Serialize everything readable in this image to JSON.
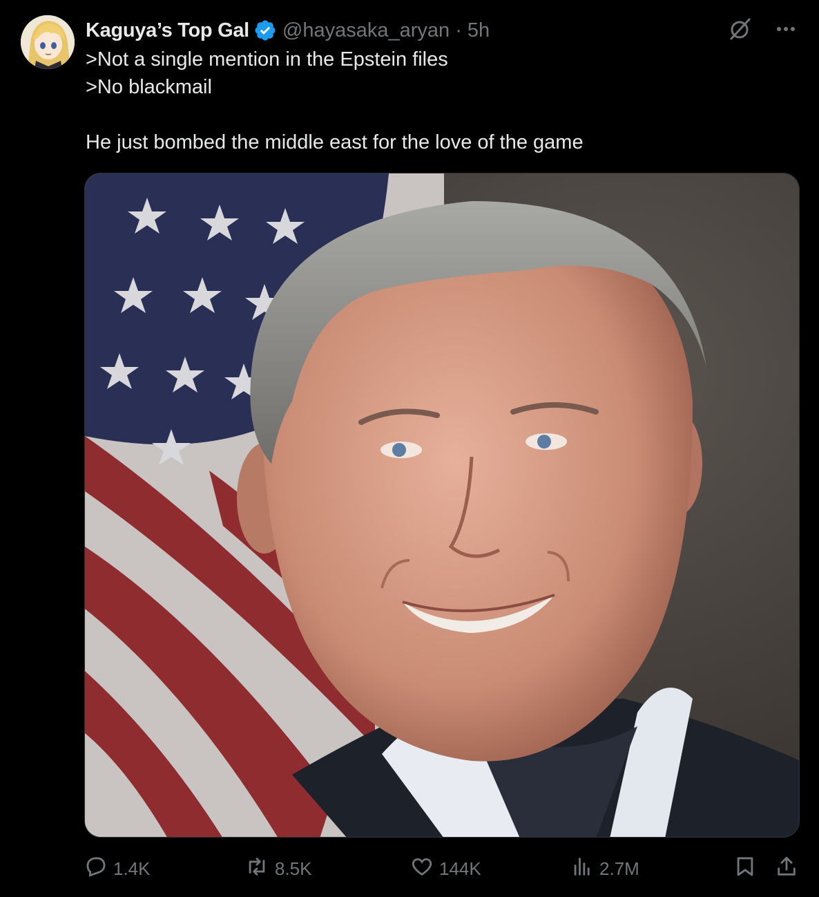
{
  "tweet": {
    "author": {
      "display_name": "Kaguya’s Top Gal",
      "handle": "@hayasaka_aryan",
      "verified": true
    },
    "separator": "·",
    "time": "5h",
    "text_lines": [
      ">Not a single mention in the Epstein files",
      ">No blackmail",
      "",
      "He just bombed the middle east for the love of the game"
    ],
    "media": {
      "kind": "portrait-photo"
    },
    "stats": {
      "replies": "1.4K",
      "reposts": "8.5K",
      "likes": "144K",
      "views": "2.7M"
    },
    "icons": {
      "verified": "verified-badge-icon",
      "grok": "grok-icon",
      "more": "more-icon",
      "reply": "reply-icon",
      "repost": "repost-icon",
      "like": "heart-icon",
      "views": "views-icon",
      "bookmark": "bookmark-icon",
      "share": "share-icon"
    },
    "colors": {
      "background": "#000000",
      "text": "#e7e9ea",
      "muted": "#71767b",
      "verified": "#1d9bf0"
    }
  }
}
